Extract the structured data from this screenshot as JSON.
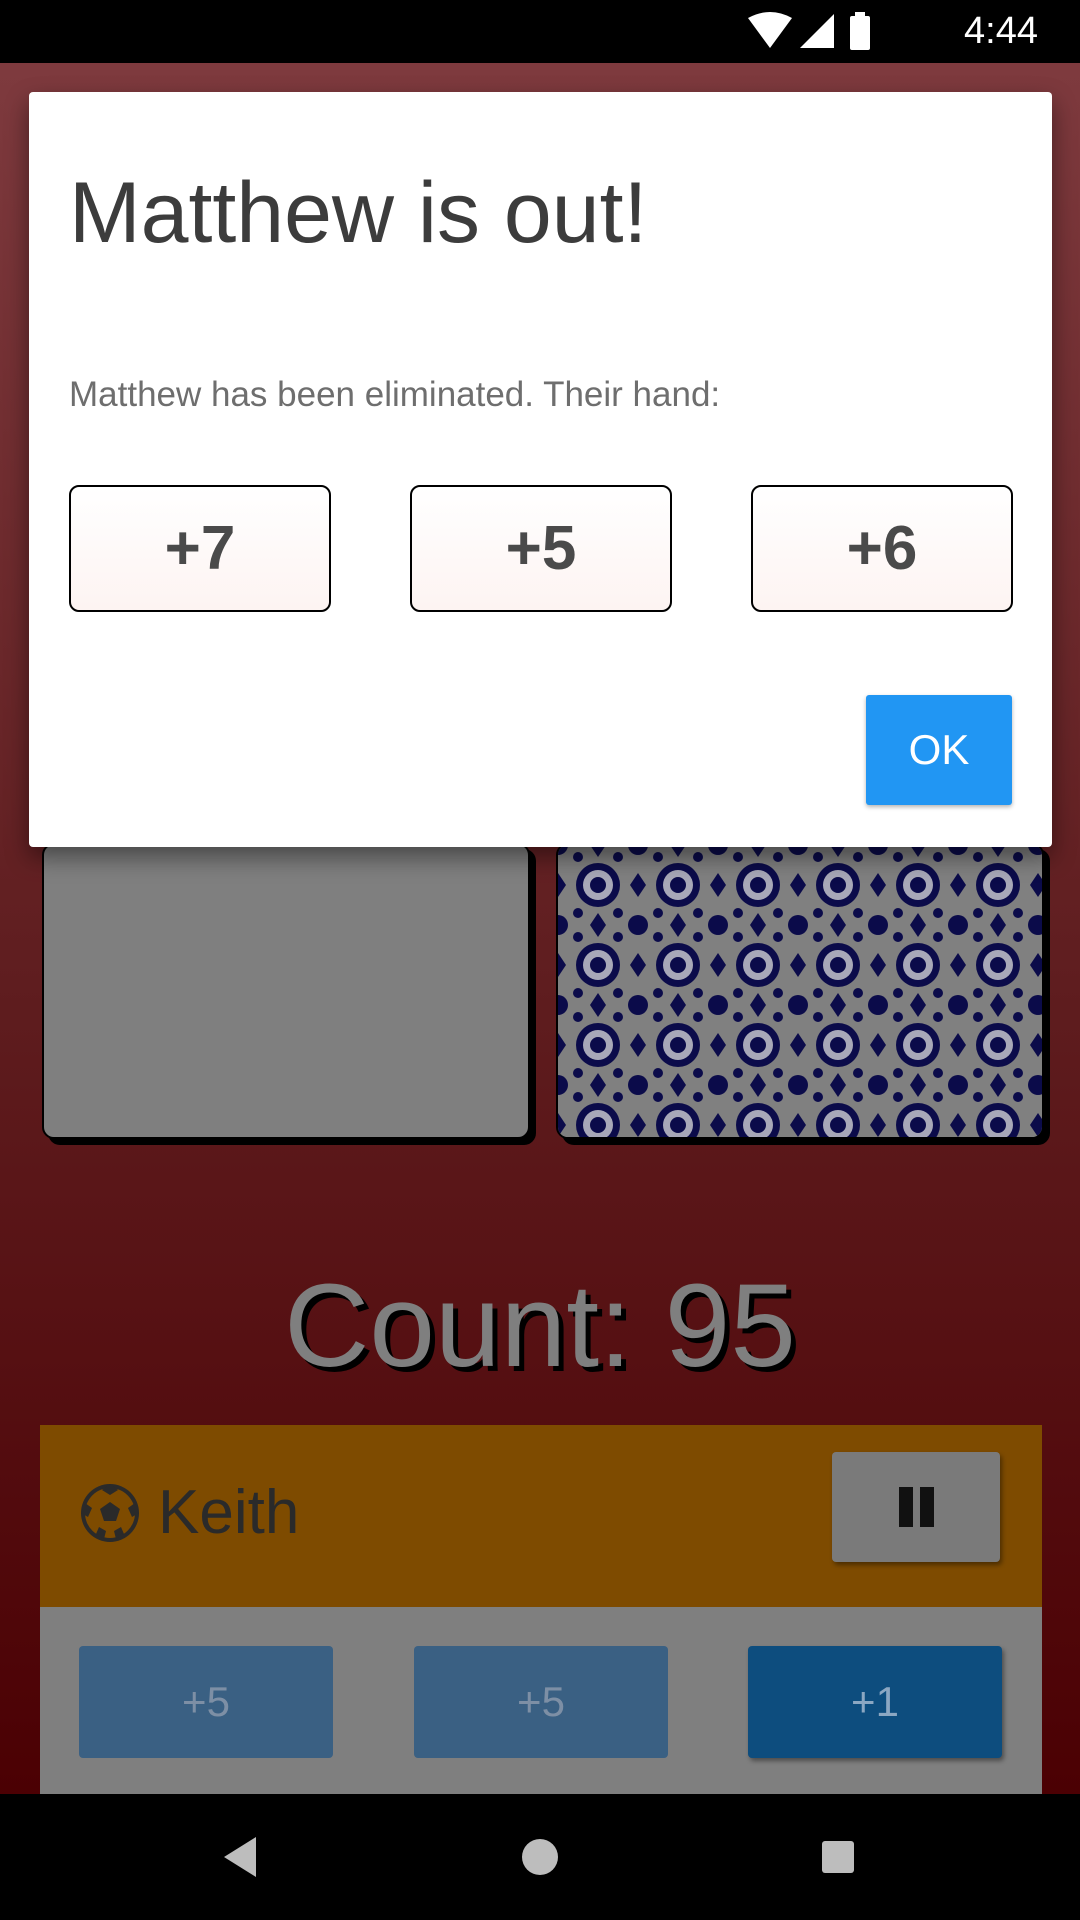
{
  "status_bar": {
    "time": "4:44",
    "icons": [
      "wifi-icon",
      "cell-signal-icon",
      "battery-icon"
    ]
  },
  "game": {
    "count_text": "Count: 95",
    "current_player": {
      "icon": "soccer-ball-icon",
      "name": "Keith",
      "pause_icon": "pause-icon"
    },
    "hand": [
      {
        "label": "+5",
        "state": "dim"
      },
      {
        "label": "+5",
        "state": "dim"
      },
      {
        "label": "+1",
        "state": "active"
      }
    ]
  },
  "dialog": {
    "title": "Matthew is out!",
    "message": "Matthew has been eliminated. Their hand:",
    "cards": [
      "+7",
      "+5",
      "+6"
    ],
    "ok_label": "OK"
  },
  "nav_bar": {
    "icons": [
      "back-icon",
      "home-icon",
      "recents-icon"
    ]
  },
  "colors": {
    "dialog_button": "#2196f3",
    "player_bar": "#7e4b00",
    "card_pattern": "#0b0b4a"
  }
}
